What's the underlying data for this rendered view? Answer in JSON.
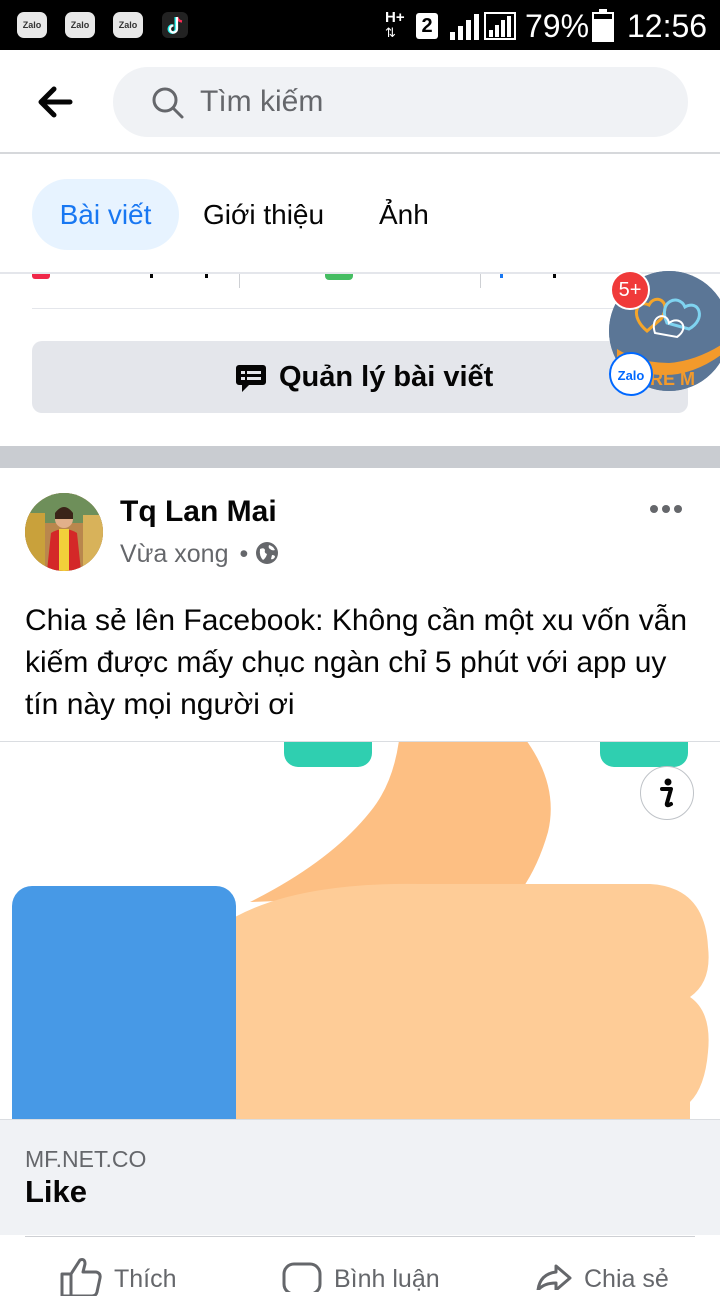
{
  "status_bar": {
    "apps": [
      "Zalo",
      "Zalo",
      "Zalo"
    ],
    "network": "H+",
    "sim": "2",
    "battery": "79%",
    "time": "12:56"
  },
  "header": {
    "search_placeholder": "Tìm kiếm"
  },
  "tabs": [
    {
      "label": "Bài viết",
      "active": true
    },
    {
      "label": "Giới thiệu",
      "active": false
    },
    {
      "label": "Ảnh",
      "active": false
    }
  ],
  "manage_posts": {
    "label": "Quản lý bài viết"
  },
  "floating_bubble": {
    "badge": "5+",
    "app": "Zalo"
  },
  "post": {
    "author": "Tq Lan Mai",
    "time": "Vừa xong",
    "separator": "•",
    "text": "Chia sẻ lên Facebook: Không cần một xu vốn vẫn kiếm được mấy chục ngàn chỉ 5 phút với app uy tín này mọi người ơi",
    "link": {
      "domain": "MF.NET.CO",
      "title": "Like"
    },
    "actions": [
      {
        "label": "Thích",
        "icon": "like-icon"
      },
      {
        "label": "Bình luận",
        "icon": "comment-icon"
      },
      {
        "label": "Chia sẻ",
        "icon": "share-icon"
      }
    ]
  },
  "colors": {
    "accent": "#1877f2",
    "tab_active_bg": "#e7f3ff",
    "thumb_skin": "#fecc97",
    "cuff_blue": "#4799e6",
    "teal": "#2fcfb0"
  }
}
